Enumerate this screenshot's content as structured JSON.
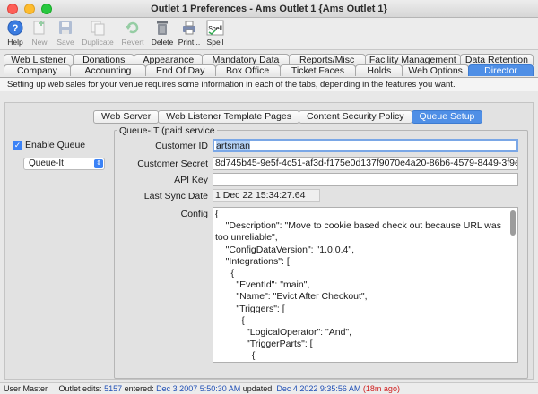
{
  "window": {
    "title": "Outlet 1 Preferences - Ams Outlet 1 {Ams Outlet 1}"
  },
  "toolbar": {
    "items": [
      {
        "label": "Help",
        "icon": "help-icon",
        "enabled": true
      },
      {
        "label": "New",
        "icon": "new-icon",
        "enabled": false
      },
      {
        "label": "Save",
        "icon": "save-icon",
        "enabled": false
      },
      {
        "label": "Duplicate",
        "icon": "duplicate-icon",
        "enabled": false
      },
      {
        "label": "Revert",
        "icon": "revert-icon",
        "enabled": false
      },
      {
        "label": "Delete",
        "icon": "delete-icon",
        "enabled": true
      },
      {
        "label": "Print...",
        "icon": "print-icon",
        "enabled": true
      },
      {
        "label": "Spell",
        "icon": "spell-icon",
        "enabled": true,
        "badge": "Spell"
      }
    ]
  },
  "tabs": {
    "row1": [
      "Web Listener",
      "Donations",
      "Appearance",
      "Mandatory Data",
      "Reports/Misc",
      "Facility Management",
      "Data Retention"
    ],
    "row2": [
      "Company",
      "Accounting",
      "End Of Day",
      "Box Office",
      "Ticket Faces",
      "Holds",
      "Web Options",
      "Director"
    ],
    "active": "Director"
  },
  "help_text": "Setting up web sales for your venue requires some information in each of the tabs, depending in the features you want.",
  "subtabs": {
    "items": [
      "Web Server",
      "Web Listener Template Pages",
      "Content Security Policy",
      "Queue Setup"
    ],
    "active": "Queue Setup"
  },
  "queue": {
    "enable_label": "Enable Queue",
    "enabled": true,
    "provider": "Queue-It",
    "group_title": "Queue-IT (paid service",
    "customer_id_label": "Customer ID",
    "customer_id": "artsman",
    "customer_secret_label": "Customer Secret",
    "customer_secret": "8d745b45-9e5f-4c51-af3d-f175e0d137f9070e4a20-86b6-4579-8449-3f9e",
    "api_key_label": "API Key",
    "api_key": "",
    "last_sync_label": "Last Sync Date",
    "last_sync": "1 Dec 22  15:34:27.64",
    "config_label": "Config",
    "config": "{\n    \"Description\": \"Move to cookie based check out because URL was too unreliable\",\n    \"ConfigDataVersion\": \"1.0.0.4\",\n    \"Integrations\": [\n      {\n        \"EventId\": \"main\",\n        \"Name\": \"Evict After Checkout\",\n        \"Triggers\": [\n          {\n            \"LogicalOperator\": \"And\",\n            \"TriggerParts\": [\n              {\n                \"IsNegative\": false,\n                \"HttpHeaderName\": null,\n                \"CookieName\": \"tm-queueit-checkedout\","
  },
  "status_bar": {
    "user": "User Master",
    "edits_label": "Outlet edits:",
    "edits": "5157",
    "entered_label": "entered:",
    "entered": "Dec 3 2007 5:50:30 AM",
    "updated_label": "updated:",
    "updated": "Dec 4 2022 9:35:56 AM",
    "ago": "(18m ago)"
  },
  "colors": {
    "accent": "#4f8fe6",
    "link": "#1f4fb5",
    "alert": "#d02020"
  }
}
